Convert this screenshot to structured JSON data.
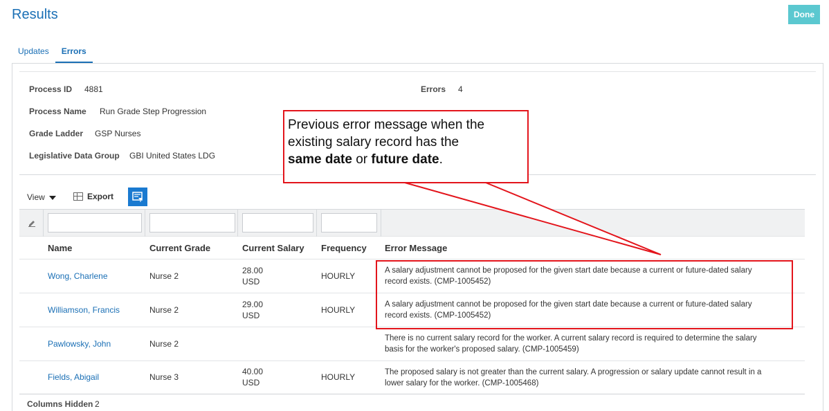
{
  "header": {
    "title": "Results",
    "done_label": "Done"
  },
  "tabs": [
    {
      "label": "Updates",
      "active": false
    },
    {
      "label": "Errors",
      "active": true
    }
  ],
  "process_info": {
    "process_id_label": "Process ID",
    "process_id": "4881",
    "errors_label": "Errors",
    "errors": "4",
    "process_name_label": "Process Name",
    "process_name": "Run Grade Step Progression",
    "grade_ladder_label": "Grade Ladder",
    "grade_ladder": "GSP Nurses",
    "ldg_label": "Legislative Data Group",
    "ldg": "GBI United States LDG"
  },
  "toolbar": {
    "view_label": "View",
    "export_label": "Export"
  },
  "table": {
    "columns": [
      "Name",
      "Current Grade",
      "Current Salary",
      "Frequency",
      "Error Message"
    ],
    "rows": [
      {
        "name": "Wong, Charlene",
        "grade": "Nurse 2",
        "salary": "28.00",
        "currency": "USD",
        "frequency": "HOURLY",
        "error_l1": "A salary adjustment cannot be proposed for the given start date because a current or future-dated salary",
        "error_l2": "record exists. (CMP-1005452)"
      },
      {
        "name": "Williamson, Francis",
        "grade": "Nurse 2",
        "salary": "29.00",
        "currency": "USD",
        "frequency": "HOURLY",
        "error_l1": "A salary adjustment cannot be proposed for the given start date because a current or future-dated salary",
        "error_l2": "record exists. (CMP-1005452)"
      },
      {
        "name": "Pawlowsky, John",
        "grade": "Nurse 2",
        "salary": "",
        "currency": "",
        "frequency": "",
        "error_l1": "There is no current salary record for the worker. A current salary record is required to determine the salary",
        "error_l2": "basis for the worker's proposed salary. (CMP-1005459)"
      },
      {
        "name": "Fields, Abigail",
        "grade": "Nurse 3",
        "salary": "40.00",
        "currency": "USD",
        "frequency": "HOURLY",
        "error_l1": "The proposed salary is not greater than the current salary. A progression or salary update cannot result in a",
        "error_l2": "lower salary for the worker. (CMP-1005468)"
      }
    ]
  },
  "footer": {
    "columns_hidden_label": "Columns Hidden",
    "columns_hidden": "2"
  },
  "callout": {
    "line1": "Previous error message when the",
    "line2": "existing salary record has the",
    "bold1": "same date",
    "mid": "or",
    "bold2": "future date",
    "end": "."
  },
  "colors": {
    "accent": "#1a6fb5",
    "done_bg": "#5bc8d0",
    "annotation": "#e3141b"
  }
}
